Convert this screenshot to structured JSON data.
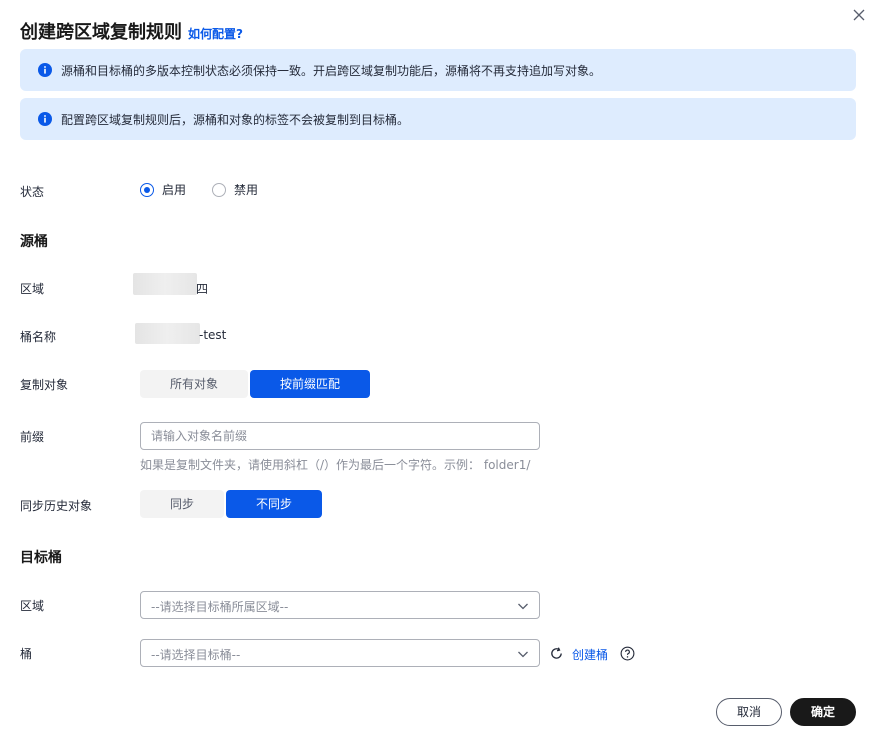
{
  "dialog": {
    "title": "创建跨区域复制规则",
    "help_link": "如何配置?",
    "alerts": [
      "源桶和目标桶的多版本控制状态必须保持一致。开启跨区域复制功能后，源桶将不再支持追加写对象。",
      "配置跨区域复制规则后，源桶和对象的标签不会被复制到目标桶。"
    ]
  },
  "status": {
    "label": "状态",
    "options": [
      "启用",
      "禁用"
    ],
    "selected": "启用"
  },
  "source": {
    "section_title": "源桶",
    "region_label": "区域",
    "region_value_visible": "四",
    "bucket_label": "桶名称",
    "bucket_value_visible": "-test"
  },
  "replicate": {
    "label": "复制对象",
    "options": [
      "所有对象",
      "按前缀匹配"
    ],
    "selected": "按前缀匹配"
  },
  "prefix": {
    "label": "前缀",
    "value": "",
    "placeholder": "请输入对象名前缀",
    "hint": "如果是复制文件夹，请使用斜杠（/）作为最后一个字符。示例： folder1/"
  },
  "history": {
    "label": "同步历史对象",
    "options": [
      "同步",
      "不同步"
    ],
    "selected": "不同步"
  },
  "target": {
    "section_title": "目标桶",
    "region_label": "区域",
    "region_placeholder": "--请选择目标桶所属区域--",
    "bucket_label": "桶",
    "bucket_placeholder": "--请选择目标桶--",
    "create_link": "创建桶"
  },
  "footer": {
    "cancel": "取消",
    "confirm": "确定"
  },
  "colors": {
    "accent": "#0a59e8",
    "alert_bg": "#deecfe",
    "primary_button": "#191919"
  }
}
